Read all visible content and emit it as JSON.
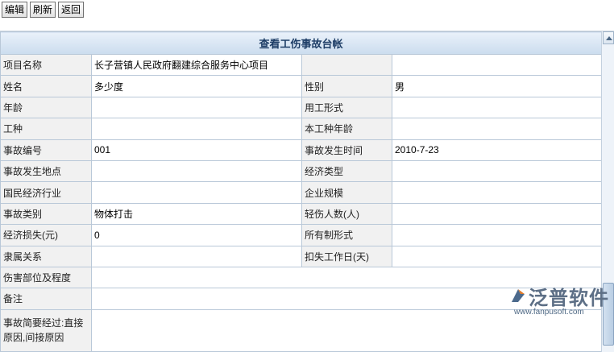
{
  "toolbar": {
    "edit_label": "编辑",
    "refresh_label": "刷新",
    "back_label": "返回"
  },
  "form": {
    "title": "查看工伤事故台帐",
    "rows": [
      {
        "l1": "项目名称",
        "v1": "长子营镇人民政府翻建综合服务中心项目",
        "l2": "",
        "v2": ""
      },
      {
        "l1": "姓名",
        "v1": "多少度",
        "l2": "性别",
        "v2": "男"
      },
      {
        "l1": "年龄",
        "v1": "",
        "l2": "用工形式",
        "v2": ""
      },
      {
        "l1": "工种",
        "v1": "",
        "l2": "本工种年龄",
        "v2": ""
      },
      {
        "l1": "事故编号",
        "v1": "001",
        "l2": "事故发生时间",
        "v2": "2010-7-23"
      },
      {
        "l1": "事故发生地点",
        "v1": "",
        "l2": "经济类型",
        "v2": ""
      },
      {
        "l1": "国民经济行业",
        "v1": "",
        "l2": "企业规模",
        "v2": ""
      },
      {
        "l1": "事故类别",
        "v1": "物体打击",
        "l2": "轻伤人数(人)",
        "v2": ""
      },
      {
        "l1": "经济损失(元)",
        "v1": "0",
        "l2": "所有制形式",
        "v2": ""
      },
      {
        "l1": "隶属关系",
        "v1": "",
        "l2": "扣失工作日(天)",
        "v2": ""
      }
    ],
    "injury_label": "伤害部位及程度",
    "injury_value": "",
    "remark_label": "备注",
    "remark_value": "",
    "summary_label": "事故简要经过:直接原因,间接原因",
    "summary_value": ""
  },
  "logo": {
    "name": "泛普软件",
    "url": "www.fanpusoft.com"
  }
}
